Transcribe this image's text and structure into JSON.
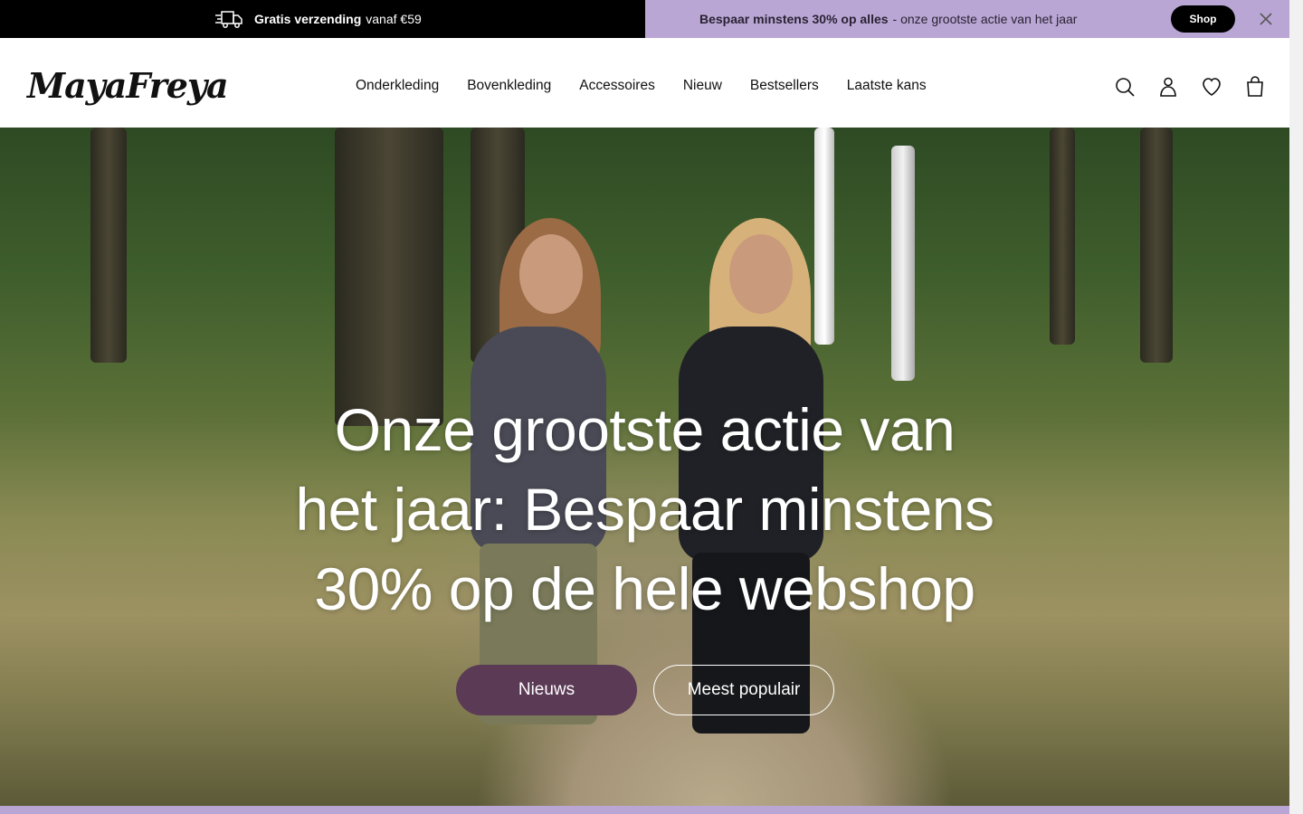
{
  "announcement": {
    "left": {
      "bold": "Gratis verzending",
      "rest": "vanaf €59",
      "icon": "truck-icon"
    },
    "right": {
      "bold": "Bespaar minstens 30% op alles",
      "rest": "- onze grootste actie van het jaar",
      "shop_label": "Shop",
      "close_icon": "close-icon"
    },
    "colors": {
      "left_bg": "#000000",
      "right_bg": "#b9a6d4"
    }
  },
  "header": {
    "logo": "MayaFreya",
    "nav": [
      "Onderkleding",
      "Bovenkleding",
      "Accessoires",
      "Nieuw",
      "Bestsellers",
      "Laatste kans"
    ],
    "icons": [
      "search-icon",
      "account-icon",
      "wishlist-heart-icon",
      "cart-bag-icon"
    ]
  },
  "hero": {
    "title_lines": [
      "Onze grootste actie van",
      "het jaar: Bespaar minstens",
      "30% op de hele webshop"
    ],
    "primary_button": "Nieuws",
    "secondary_button": "Meest populair",
    "colors": {
      "primary_button_bg": "#5b3a55"
    }
  }
}
